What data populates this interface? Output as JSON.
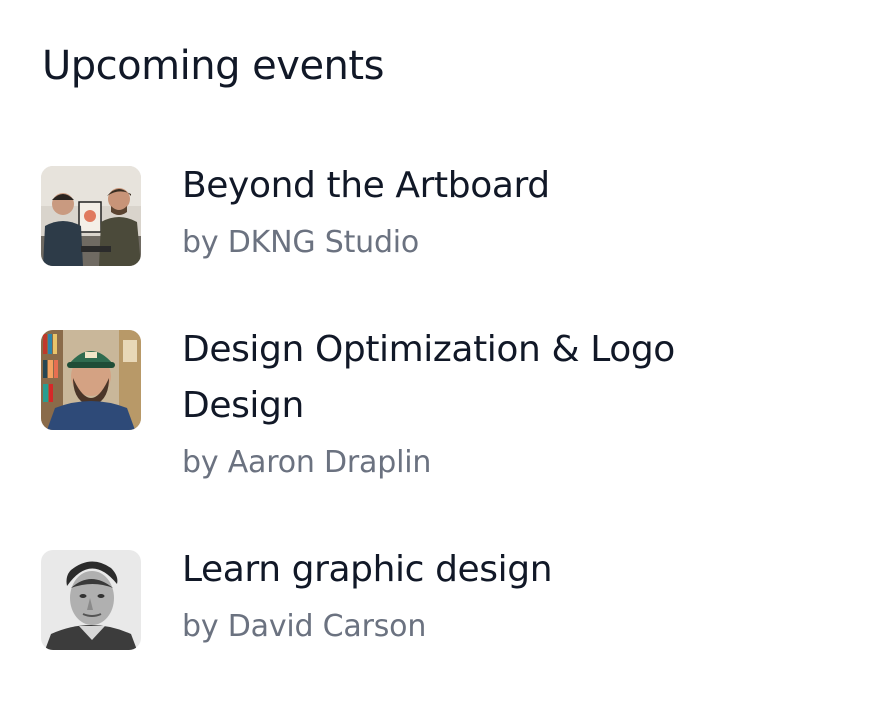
{
  "section": {
    "title": "Upcoming events"
  },
  "events": [
    {
      "title": "Beyond the Artboard",
      "author": "by DKNG Studio",
      "thumbnail": "two-men-studio-photo"
    },
    {
      "title": "Design Optimization & Logo Design",
      "author": "by Aaron Draplin",
      "thumbnail": "bearded-man-cap-photo"
    },
    {
      "title": "Learn graphic design",
      "author": "by David Carson",
      "thumbnail": "bw-portrait-photo"
    }
  ],
  "colors": {
    "title": "#111827",
    "secondary_text": "#6b7280",
    "background": "#ffffff"
  }
}
